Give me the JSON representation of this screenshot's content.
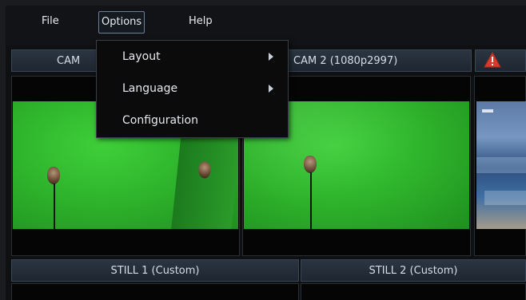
{
  "menubar": {
    "file": "File",
    "options": "Options",
    "help": "Help"
  },
  "options_menu": {
    "items": [
      {
        "label": "Layout",
        "has_submenu": true
      },
      {
        "label": "Language",
        "has_submenu": true
      },
      {
        "label": "Configuration",
        "has_submenu": false
      }
    ]
  },
  "sources": {
    "cam1": "CAM",
    "cam2": "CAM 2 (1080p2997)",
    "still1": "STILL 1 (Custom)",
    "still2": "STILL 2 (Custom)"
  },
  "colors": {
    "warning": "#d63b2b",
    "bar_top": "#2b3542",
    "bar_bottom": "#1e2630",
    "green_screen": "#2fb52c"
  },
  "icons": {
    "warning": "warning-triangle-icon",
    "submenu_arrow": "chevron-right-icon"
  }
}
